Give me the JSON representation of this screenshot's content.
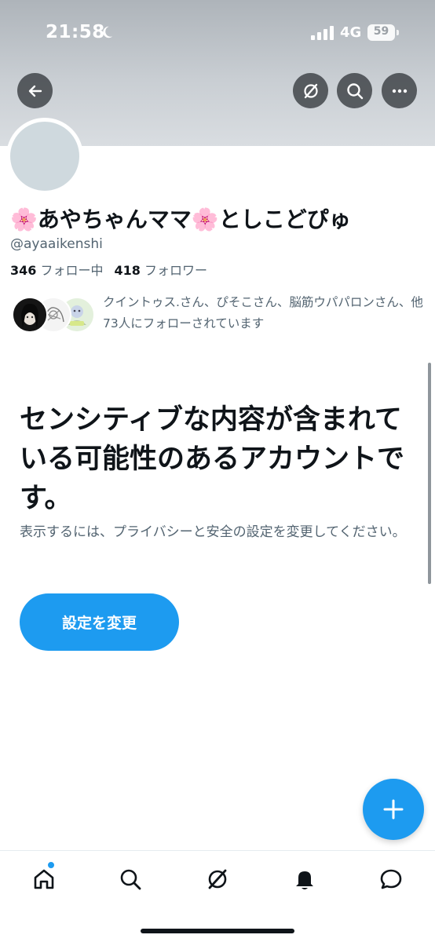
{
  "status_bar": {
    "time": "21:58",
    "network": "4G",
    "battery": "59"
  },
  "profile": {
    "display_name": "🌸あやちゃんママ🌸としこどぴゅ",
    "handle": "@ayaaikenshi",
    "following_count": "346",
    "following_label": "フォロー中",
    "followers_count": "418",
    "followers_label": "フォロワー",
    "followed_by_text": "クイントゥス.さん、ぴそこさん、脳筋ウパパロンさん、他73人にフォローされています"
  },
  "sensitive": {
    "title": "センシティブな内容が含まれている可能性のあるアカウントです。",
    "body": "表示するには、プライバシーと安全の設定を変更してください。",
    "button_label": "設定を変更"
  },
  "tabs": [
    "home",
    "search",
    "grok",
    "notifications",
    "messages"
  ],
  "colors": {
    "accent": "#1d9bf0",
    "text_primary": "#0f1419",
    "text_secondary": "#536471",
    "avatar_placeholder": "#cfd9de"
  },
  "icons": {
    "back": "arrow-left-icon",
    "header_actions": [
      "grok-icon",
      "search-icon",
      "more-icon"
    ],
    "fab": "plus-icon"
  }
}
